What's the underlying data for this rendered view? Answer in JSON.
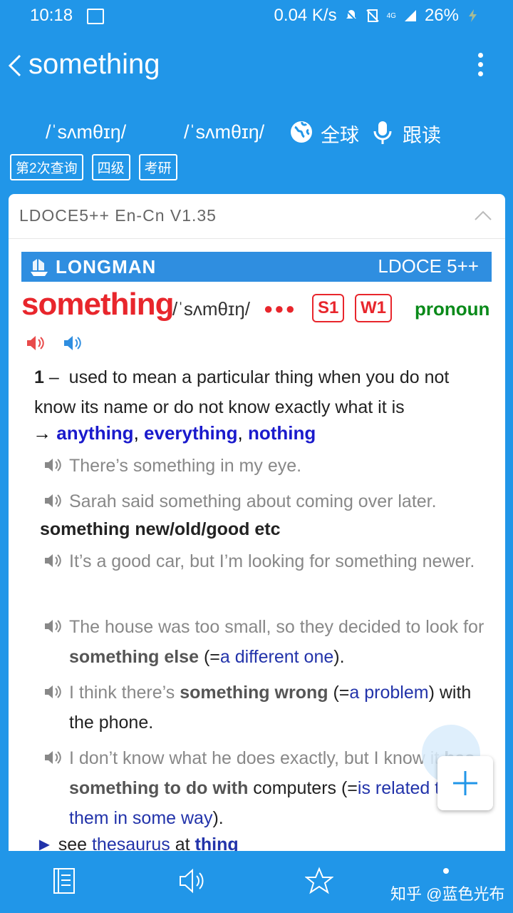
{
  "status": {
    "time": "10:18",
    "net_speed": "0.04 K/s",
    "network_tag": "4G",
    "battery": "26%"
  },
  "header": {
    "title": "something"
  },
  "pron": {
    "uk": "/ˈsʌmθɪŋ/",
    "us": "/ˈsʌmθɪŋ/",
    "global_label": "全球",
    "read_label": "跟读"
  },
  "tags": [
    "第2次查询",
    "四级",
    "考研"
  ],
  "dict": {
    "name": "LDOCE5++ En-Cn V1.35",
    "brand": "LONGMAN",
    "version": "LDOCE 5++"
  },
  "entry": {
    "headword": "something",
    "phonetic": "/ˈsʌmθɪŋ/",
    "frequency": "●●●",
    "badges": [
      "S1",
      "W1"
    ],
    "pos": "pronoun",
    "sense": {
      "number": "1",
      "dash": "–",
      "definition": "used to mean a particular thing when you do not know its name or do not know exactly what it is",
      "arrow": "→",
      "xrefs": [
        "anything",
        "everything",
        "nothing"
      ]
    },
    "examples": [
      {
        "text": "There’s something in my eye."
      },
      {
        "text": "Sarah said something about coming over later."
      }
    ],
    "pattern": "something new/old/good etc",
    "examples2": [
      {
        "pre": "It’s a good car, but I’m looking for something newer.",
        "bold": "",
        "gloss": "",
        "post": ""
      },
      {
        "pre": "The house was too small, so they decided to look for ",
        "bold": "something else",
        "mid": " (=",
        "gloss": "a different one",
        "post": ")."
      },
      {
        "pre": "I think there’s ",
        "bold": "something wrong",
        "mid": " (=",
        "gloss": "a problem",
        "post": ") with the phone."
      },
      {
        "pre": "I don’t know what he does exactly, but I know it ",
        "bold": "has something to do with",
        "mid": " computers (=",
        "gloss": "is related to them in some way",
        "post": ")."
      }
    ],
    "see": {
      "arrow": "►",
      "text": "see",
      "link": "thesaurus",
      "at": "at",
      "target": "thing"
    }
  },
  "watermark": "知乎 @蓝色光布",
  "colors": {
    "primary": "#2196e8",
    "headword": "#e8262c",
    "pos": "#0a8a1a",
    "xref": "#1a1acc"
  }
}
